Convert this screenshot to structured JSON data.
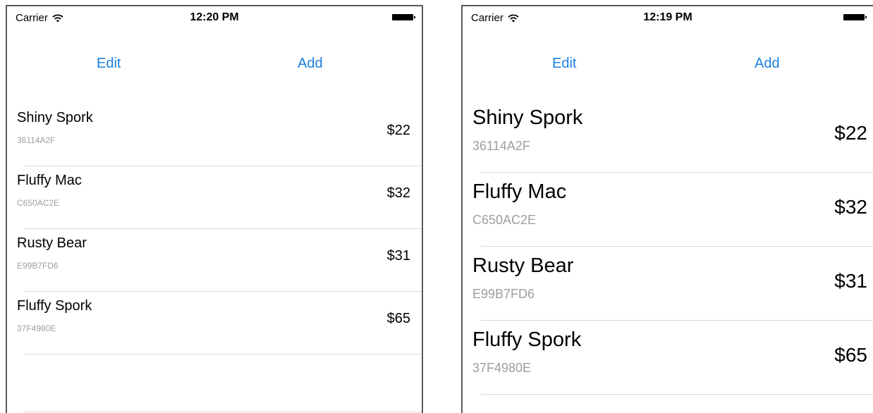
{
  "screens": [
    {
      "status": {
        "carrier": "Carrier",
        "time": "12:20 PM"
      },
      "nav": {
        "edit_label": "Edit",
        "add_label": "Add"
      },
      "items": [
        {
          "name": "Shiny Spork",
          "serial": "36114A2F",
          "price": "$22"
        },
        {
          "name": "Fluffy Mac",
          "serial": "C650AC2E",
          "price": "$32"
        },
        {
          "name": "Rusty Bear",
          "serial": "E99B7FD6",
          "price": "$31"
        },
        {
          "name": "Fluffy Spork",
          "serial": "37F4980E",
          "price": "$65"
        }
      ]
    },
    {
      "status": {
        "carrier": "Carrier",
        "time": "12:19 PM"
      },
      "nav": {
        "edit_label": "Edit",
        "add_label": "Add"
      },
      "items": [
        {
          "name": "Shiny Spork",
          "serial": "36114A2F",
          "price": "$22"
        },
        {
          "name": "Fluffy Mac",
          "serial": "C650AC2E",
          "price": "$32"
        },
        {
          "name": "Rusty Bear",
          "serial": "E99B7FD6",
          "price": "$31"
        },
        {
          "name": "Fluffy Spork",
          "serial": "37F4980E",
          "price": "$65"
        }
      ]
    }
  ],
  "colors": {
    "tint": "#1a7fe0",
    "secondary_text": "#9e9e9e",
    "separator": "#d8d8d8"
  },
  "icons": {
    "wifi": "wifi-icon",
    "battery": "battery-icon"
  }
}
